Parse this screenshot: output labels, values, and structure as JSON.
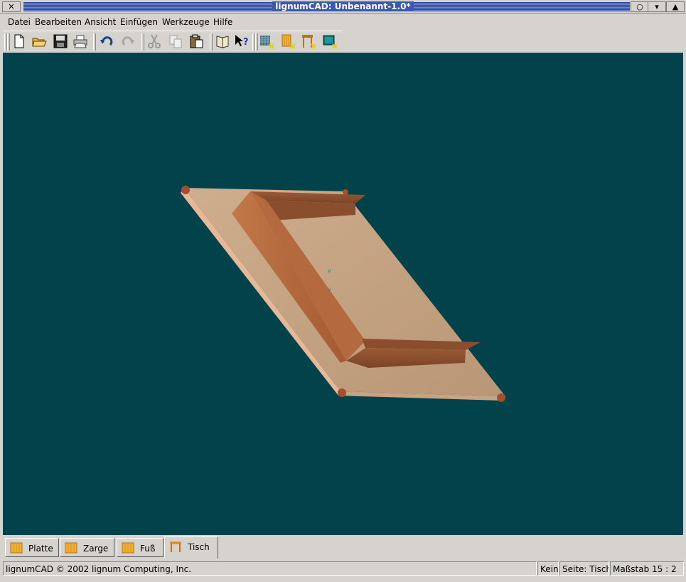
{
  "window": {
    "title": "lignumCAD: Unbenannt-1.0*",
    "close_glyph": "✕",
    "buttons": [
      "○",
      "▾",
      "▲"
    ]
  },
  "menu": [
    {
      "label": "Datei"
    },
    {
      "label": "Bearbeiten"
    },
    {
      "label": "Ansicht"
    },
    {
      "label": "Einfügen"
    },
    {
      "label": "Werkzeuge"
    },
    {
      "label": "Hilfe"
    }
  ],
  "toolbar": {
    "icons": [
      "new-file-icon",
      "open-folder-icon",
      "save-icon",
      "print-icon",
      "undo-icon",
      "redo-icon",
      "cut-icon",
      "copy-icon",
      "paste-icon",
      "manual-icon",
      "whats-this-icon",
      "new-board-icon",
      "new-frame-icon",
      "new-leg-icon",
      "new-table-icon"
    ]
  },
  "viewport": {
    "background": "#02424a"
  },
  "tabs": [
    {
      "label": "Platte",
      "icon": "board-icon"
    },
    {
      "label": "Zarge",
      "icon": "frame-icon"
    },
    {
      "label": "Fuß",
      "icon": "leg-icon"
    },
    {
      "label": "Tisch",
      "icon": "table-icon",
      "active": true
    }
  ],
  "status": {
    "message": "lignumCAD © 2002 lignum Computing, Inc.",
    "selection": "Kein",
    "page": "Seite: Tisch",
    "scale": "Maßstab 15 : 2"
  }
}
